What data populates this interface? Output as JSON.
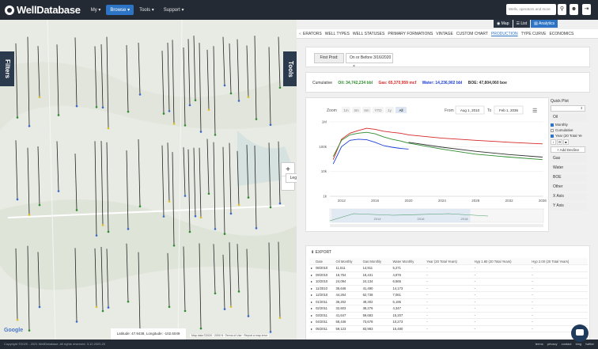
{
  "nav": {
    "logo": "WellDatabase",
    "menu": [
      {
        "label": "My ▾"
      },
      {
        "label": "Browse ▾"
      },
      {
        "label": "Tools ▾"
      },
      {
        "label": "Support ▾"
      }
    ],
    "search_placeholder": "Wells, operators and more",
    "icons": [
      "search-icon",
      "user-icon",
      "logout-icon"
    ]
  },
  "view_toggle": {
    "map": "Map",
    "list": "List",
    "analytics": "Analytics"
  },
  "map": {
    "filters_tab": "Filters",
    "tools_tab": "Tools",
    "zoom_in": "+",
    "zoom_out": "−",
    "legend": "Legend",
    "coords": "Latitude: 47.9438, Longitude: -102.6049",
    "google": "Google",
    "attribution": "Map data ©2020 · 2000 ft · Terms of Use · Report a map error"
  },
  "tabs": [
    "ERATORS",
    "WELL TYPES",
    "WELL STATUSES",
    "PRIMARY FORMATIONS",
    "VINTAGE",
    "CUSTOM CHART",
    "PRODUCTION",
    "TYPE CURVE",
    "ECONOMICS"
  ],
  "active_tab": "PRODUCTION",
  "filter": {
    "label": "First Prod:",
    "value": "On or Before 3/16/2020"
  },
  "cumulative": {
    "label": "Cumulative",
    "oil": "Oil: 34,742,234 bbl",
    "gas": "Gas: 65,370,959 mcf",
    "water": "Water: 14,236,902 bbl",
    "boe": "BOE: 47,804,060 boe"
  },
  "colors": {
    "oil": "#2e8b2e",
    "gas": "#d62728",
    "water": "#1f3fd6",
    "boe": "#333333",
    "accent": "#2d74c4"
  },
  "chart_controls": {
    "zoom_label": "Zoom",
    "zoom_options": [
      "1m",
      "3m",
      "6m",
      "YTD",
      "1y",
      "All"
    ],
    "from_label": "From",
    "from_value": "Aug 1, 2010",
    "to_label": "To",
    "to_value": "Feb 1, 2036"
  },
  "chart_data": {
    "type": "line",
    "title": "",
    "xlabel": "",
    "ylabel": "",
    "yscale": "log",
    "ylim": [
      1000,
      1000000
    ],
    "y_ticks": [
      "1k",
      "10k",
      "100k",
      "1M"
    ],
    "x_ticks": [
      "2012",
      "2016",
      "2020",
      "2024",
      "2028",
      "2032",
      "2036"
    ],
    "xlim": [
      2010.6,
      2036.1
    ],
    "navigator_ticks": [
      "2014",
      "2016",
      "2018"
    ],
    "series": [
      {
        "name": "Gas",
        "color": "#d62728",
        "x": [
          2011,
          2012,
          2013,
          2014,
          2015,
          2016,
          2017,
          2018,
          2019,
          2020,
          2024,
          2028,
          2032,
          2036
        ],
        "y": [
          30000,
          200000,
          350000,
          450000,
          550000,
          500000,
          420000,
          380000,
          350000,
          300000,
          220000,
          180000,
          150000,
          130000
        ]
      },
      {
        "name": "Oil",
        "color": "#2e8b2e",
        "x": [
          2011,
          2012,
          2013,
          2014,
          2015,
          2016,
          2017,
          2018,
          2019,
          2020,
          2024,
          2028,
          2032,
          2036
        ],
        "y": [
          40000,
          180000,
          300000,
          350000,
          380000,
          330000,
          250000,
          200000,
          170000,
          140000,
          80000,
          50000,
          38000,
          30000
        ]
      },
      {
        "name": "Water",
        "color": "#1f3fd6",
        "x": [
          2011,
          2012,
          2013,
          2014,
          2015,
          2016,
          2017,
          2018,
          2019,
          2020
        ],
        "y": [
          20000,
          100000,
          180000,
          200000,
          190000,
          150000,
          110000,
          95000,
          85000,
          80000
        ]
      },
      {
        "name": "BOE",
        "color": "#333333",
        "x": [
          2020,
          2024,
          2028,
          2032,
          2036
        ],
        "y": [
          150000,
          95000,
          65000,
          48000,
          38000
        ]
      }
    ]
  },
  "quick_plot": {
    "title": "Quick Plot",
    "select_value": "⇕",
    "oil_label": "Oil",
    "monthly": "Monthly",
    "cumulative": "Cumulative",
    "year_total": "Year (20 Total Ye",
    "add_decline": "+ Add Decline",
    "sections": [
      "Gas",
      "Water",
      "BOE",
      "Other",
      "X Axis",
      "Y Axis"
    ]
  },
  "table": {
    "export": "EXPORT",
    "headers": [
      "Date",
      "Oil Monthly",
      "Gas Monthly",
      "Water Monthly",
      "Year (20 Total Years)",
      "Hyp 1.80 (20 Total Years)",
      "Hyp 2.00 (20 Total Years)"
    ],
    "rows": [
      [
        "08/2010",
        "11,511",
        "14,911",
        "5,271",
        "-",
        "-",
        "-"
      ],
      [
        "09/2010",
        "16,764",
        "18,431",
        "4,876",
        "-",
        "-",
        "-"
      ],
      [
        "10/2010",
        "24,094",
        "24,134",
        "6,565",
        "-",
        "-",
        "-"
      ],
      [
        "11/2010",
        "35,646",
        "41,490",
        "14,173",
        "-",
        "-",
        "-"
      ],
      [
        "12/2010",
        "44,264",
        "62,738",
        "7,061",
        "-",
        "-",
        "-"
      ],
      [
        "01/2011",
        "36,202",
        "49,302",
        "5,195",
        "-",
        "-",
        "-"
      ],
      [
        "02/2011",
        "32,603",
        "38,276",
        "4,347",
        "-",
        "-",
        "-"
      ],
      [
        "03/2011",
        "41,647",
        "59,683",
        "15,207",
        "-",
        "-",
        "-"
      ],
      [
        "04/2011",
        "58,446",
        "73,678",
        "10,273",
        "-",
        "-",
        "-"
      ],
      [
        "05/2011",
        "59,123",
        "83,983",
        "15,480",
        "-",
        "-",
        "-"
      ]
    ]
  },
  "footer": {
    "copyright": "Copyright ©2020 - 2021 WellDatabase. All rights reserved. 3.12.2020.20",
    "links": [
      "terms",
      "privacy",
      "contact",
      "blog",
      "twitter"
    ]
  }
}
